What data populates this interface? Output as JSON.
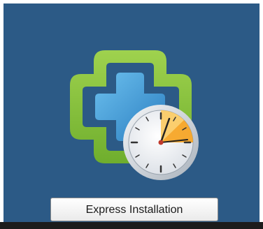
{
  "tile": {
    "background_color": "#2c5a86",
    "icon": "vmware-update-clock-icon",
    "button_label": "Express Installation"
  },
  "colors": {
    "frame_green": "#8cc63f",
    "cross_blue": "#3a8fd0",
    "clock_accent": "#f7a21c"
  }
}
